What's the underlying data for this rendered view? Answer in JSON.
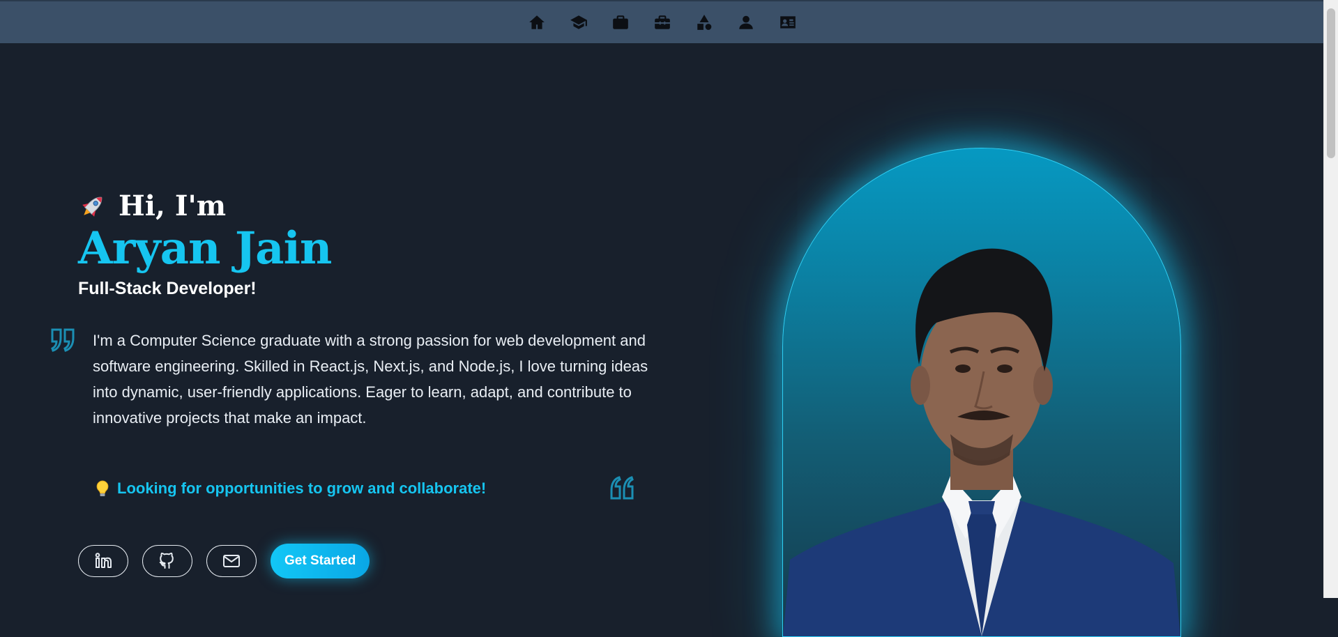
{
  "nav": {
    "items": [
      {
        "icon": "home-icon",
        "label": "Home"
      },
      {
        "icon": "graduation-cap-icon",
        "label": "Education"
      },
      {
        "icon": "briefcase-icon",
        "label": "Experience"
      },
      {
        "icon": "toolbox-icon",
        "label": "Projects"
      },
      {
        "icon": "shapes-icon",
        "label": "Skills"
      },
      {
        "icon": "user-icon",
        "label": "About"
      },
      {
        "icon": "contact-card-icon",
        "label": "Contact"
      }
    ]
  },
  "hero": {
    "greeting": "Hi, I'm",
    "name": "Aryan Jain",
    "role": "Full-Stack Developer!",
    "bio": "I'm a Computer Science graduate with a strong passion for web development and software engineering. Skilled in React.js, Next.js, and Node.js, I love turning ideas into dynamic, user-friendly applications. Eager to learn, adapt, and contribute to innovative projects that make an impact.",
    "tagline": "Looking for opportunities to grow and collaborate!",
    "cta_label": "Get Started"
  },
  "colors": {
    "accent": "#16c5f0",
    "background": "#18202c",
    "navbar": "#3b5068"
  }
}
